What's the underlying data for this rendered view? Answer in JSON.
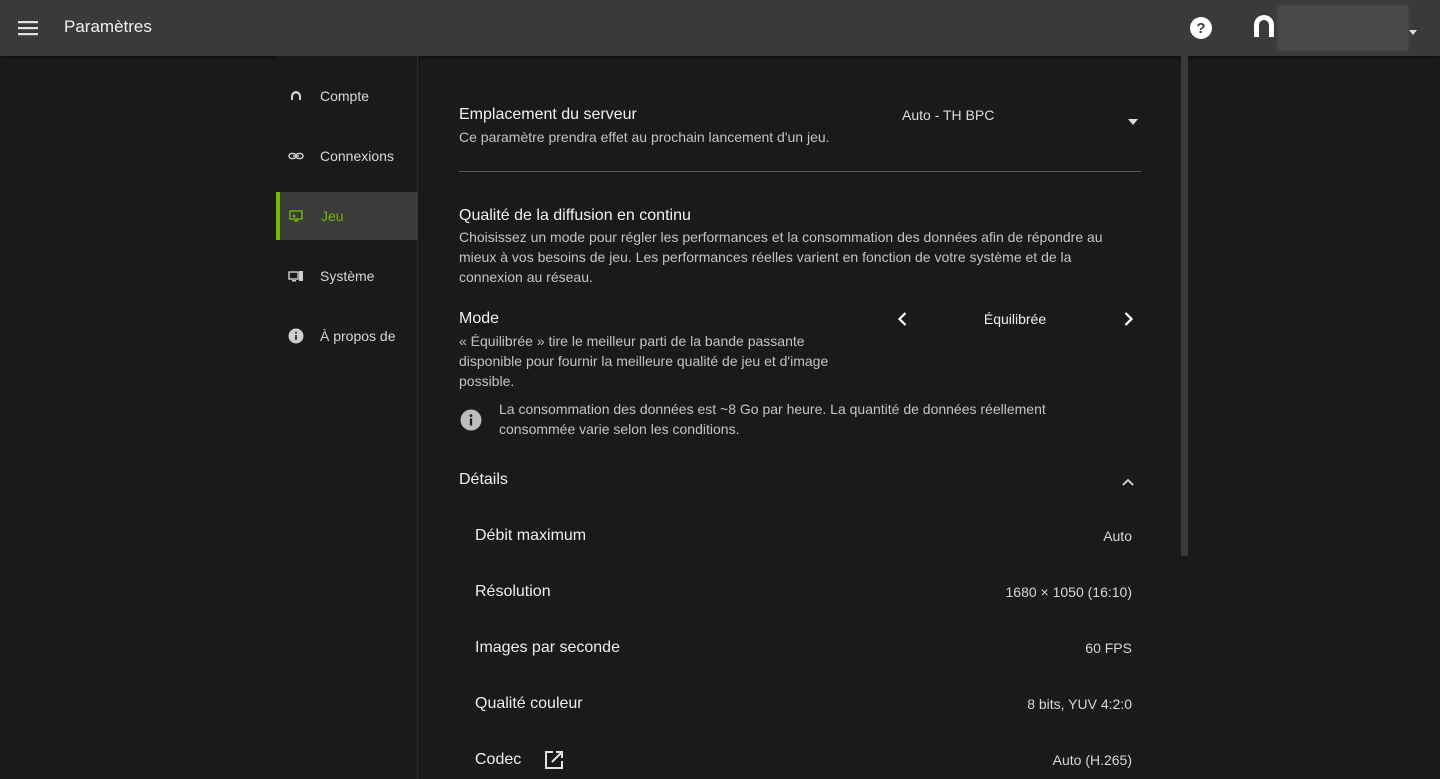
{
  "header": {
    "title": "Paramètres",
    "menu_icon": "hamburger-menu-icon",
    "help_icon": "help-circle-icon",
    "avatar_icon": "user-avatar-icon",
    "user_caret_icon": "caret-down-icon"
  },
  "sidebar": {
    "accent_color": "#76b900",
    "items": [
      {
        "label": "Compte",
        "icon": "headset-icon",
        "active": false
      },
      {
        "label": "Connexions",
        "icon": "link-icon",
        "active": false
      },
      {
        "label": "Jeu",
        "icon": "game-display-icon",
        "active": true
      },
      {
        "label": "Système",
        "icon": "system-devices-icon",
        "active": false
      },
      {
        "label": "À propos de",
        "icon": "info-icon",
        "active": false
      }
    ]
  },
  "server": {
    "title": "Emplacement du serveur",
    "description": "Ce paramètre prendra effet au prochain lancement d'un jeu.",
    "value": "Auto - TH BPC"
  },
  "quality": {
    "title": "Qualité de la diffusion en continu",
    "description_lines": [
      "Choisissez un mode pour régler les performances et la consommation des données afin de répondre au",
      "mieux à vos besoins de jeu. Les performances réelles varient en fonction de votre système et de la",
      "connexion au réseau."
    ]
  },
  "mode": {
    "title": "Mode",
    "value": "Équilibrée",
    "description_lines": [
      "« Équilibrée » tire le meilleur parti de la bande passante",
      "disponible pour fournir la meilleure qualité de jeu et d'image",
      "possible."
    ],
    "info_lines": [
      "La consommation des données est ~8 Go par heure. La quantité de données réellement",
      "consommée varie selon les conditions."
    ]
  },
  "details": {
    "title": "Détails",
    "rows": [
      {
        "label": "Débit maximum",
        "value": "Auto"
      },
      {
        "label": "Résolution",
        "value": "1680 × 1050 (16:10)"
      },
      {
        "label": "Images par seconde",
        "value": "60 FPS"
      },
      {
        "label": "Qualité couleur",
        "value": "8 bits, YUV 4:2:0"
      },
      {
        "label": "Codec",
        "value": "Auto (H.265)"
      }
    ]
  }
}
